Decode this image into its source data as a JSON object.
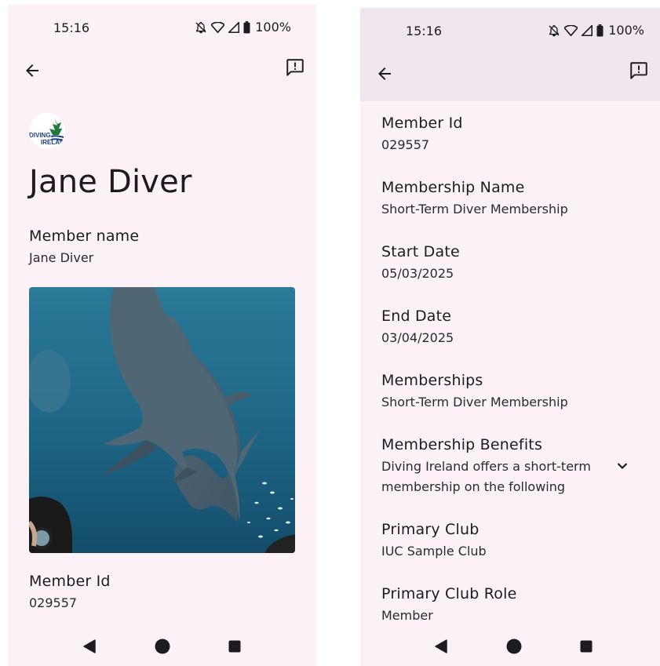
{
  "status_bar": {
    "time": "15:16",
    "battery": "100%"
  },
  "left_screen": {
    "title": "Jane Diver",
    "logo_text_line1": "DIVING",
    "logo_text_line2": "IRELAND",
    "fields": [
      {
        "label": "Member name",
        "value": "Jane Diver"
      },
      {
        "label": "Member Id",
        "value": "029557"
      }
    ]
  },
  "right_screen": {
    "fields": [
      {
        "label": "Member Id",
        "value": "029557"
      },
      {
        "label": "Membership Name",
        "value": "Short-Term Diver Membership"
      },
      {
        "label": "Start Date",
        "value": "05/03/2025"
      },
      {
        "label": "End Date",
        "value": "03/04/2025"
      },
      {
        "label": "Memberships",
        "value": "Short-Term Diver Membership"
      },
      {
        "label": "Membership Benefits",
        "value": "Diving Ireland offers a short-term membership on the following"
      },
      {
        "label": "Primary Club",
        "value": "IUC Sample Club"
      },
      {
        "label": "Primary Club Role",
        "value": "Member"
      }
    ]
  },
  "icons": {
    "back": "arrow-back-icon",
    "feedback": "feedback-icon",
    "expand": "chevron-down-icon",
    "status": [
      "bell-off-icon",
      "wifi-icon",
      "signal-icon",
      "battery-icon"
    ],
    "nav": [
      "nav-back-icon",
      "nav-home-icon",
      "nav-recents-icon"
    ]
  },
  "colors": {
    "background": "#fdf1f8",
    "app_bar_scrolled": "#efe6ee",
    "text": "#1d1b20",
    "logo_green": "#1f7a3b",
    "logo_blue": "#1f3f8a"
  }
}
